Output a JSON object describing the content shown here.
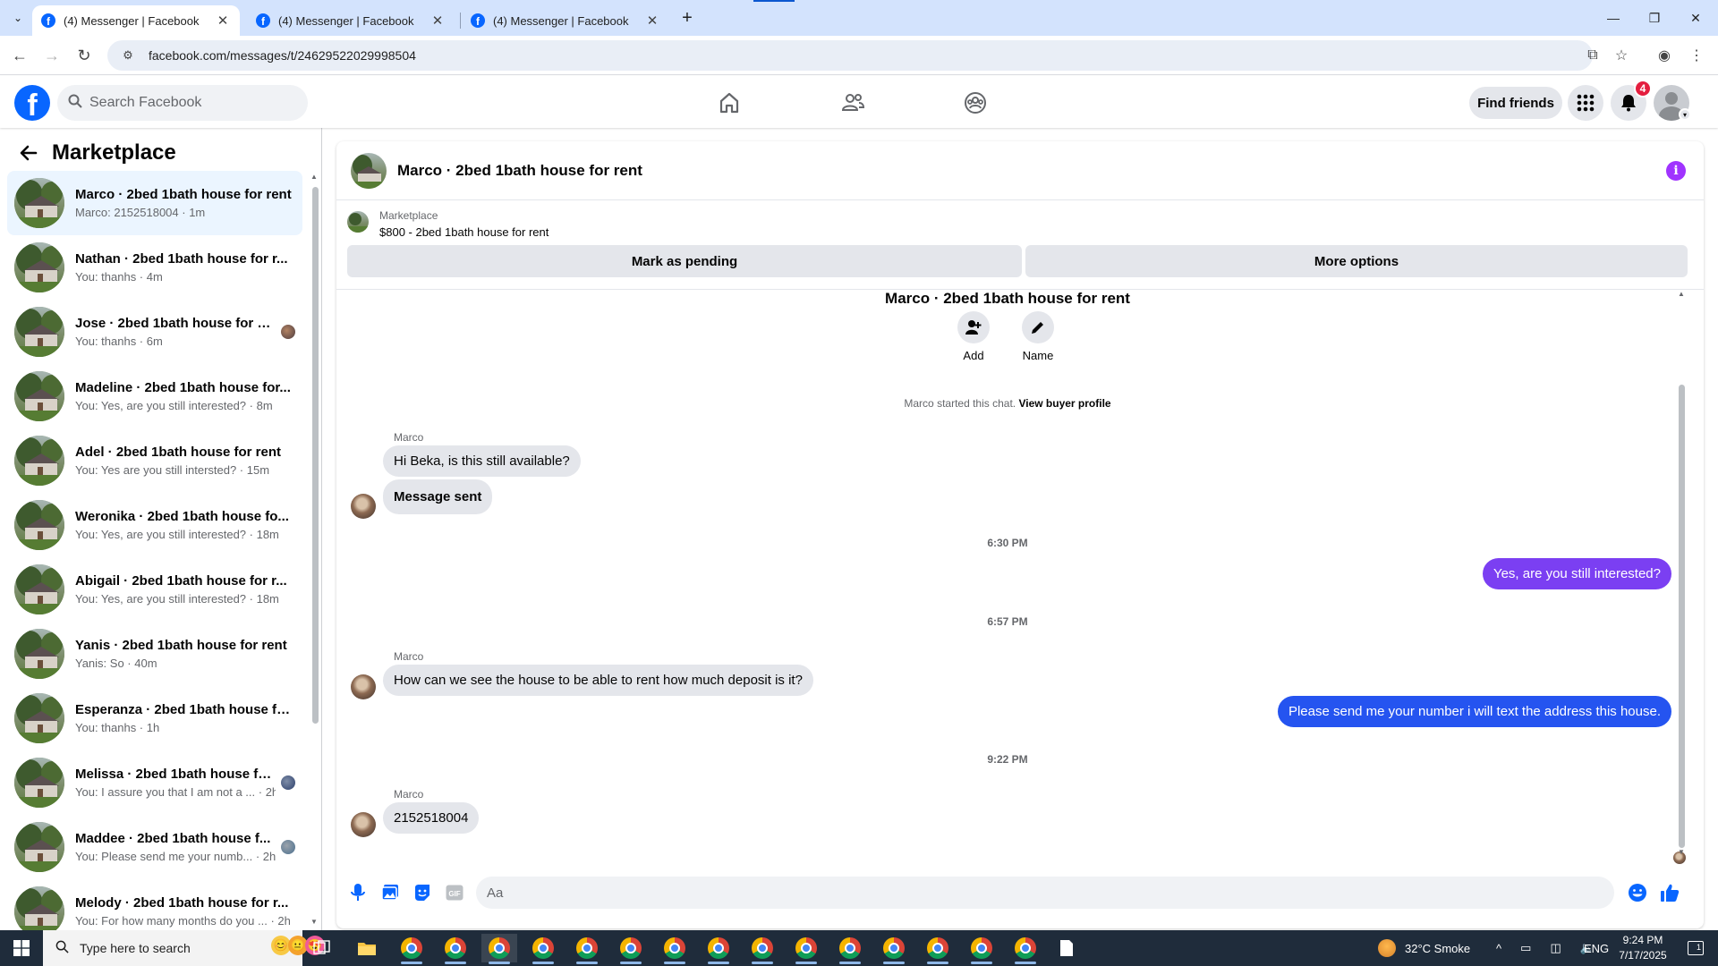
{
  "browser": {
    "tabs": [
      {
        "title": "(4) Messenger | Facebook",
        "active": true
      },
      {
        "title": "(4) Messenger | Facebook",
        "active": false
      },
      {
        "title": "(4) Messenger | Facebook",
        "active": false
      }
    ],
    "url": "facebook.com/messages/t/24629522029998504"
  },
  "header": {
    "search_placeholder": "Search Facebook",
    "find_friends": "Find friends",
    "notification_count": "4"
  },
  "sidebar": {
    "title": "Marketplace",
    "conversations": [
      {
        "name": "Marco · 2bed 1bath house for rent",
        "preview": "Marco: 2152518004 · 1m",
        "active": true
      },
      {
        "name": "Nathan · 2bed 1bath house for r...",
        "preview": "You: thanhs · 4m"
      },
      {
        "name": "Jose · 2bed 1bath house for re...",
        "preview": "You: thanhs · 6m",
        "seen": "seen-1"
      },
      {
        "name": "Madeline · 2bed 1bath house for...",
        "preview": "You: Yes, are you still interested? · 8m"
      },
      {
        "name": "Adel · 2bed 1bath house for rent",
        "preview": "You: Yes are you still intersted? · 15m"
      },
      {
        "name": "Weronika · 2bed 1bath house fo...",
        "preview": "You: Yes, are you still interested? · 18m"
      },
      {
        "name": "Abigail · 2bed 1bath house for r...",
        "preview": "You: Yes, are you still interested? · 18m"
      },
      {
        "name": "Yanis · 2bed 1bath house for rent",
        "preview": "Yanis: So · 40m"
      },
      {
        "name": "Esperanza · 2bed 1bath house fo...",
        "preview": "You: thanhs · 1h"
      },
      {
        "name": "Melissa · 2bed 1bath house fo...",
        "preview": "You: I assure you that I am not a ... · 2h",
        "seen": "seen-2"
      },
      {
        "name": "Maddee · 2bed 1bath house f...",
        "preview": "You: Please send me your numb... · 2h",
        "seen": "seen-3"
      },
      {
        "name": "Melody · 2bed 1bath house for r...",
        "preview": "You: For how many months do you ... · 2h"
      }
    ]
  },
  "chat": {
    "title": "Marco · 2bed 1bath house for rent",
    "marketplace_label": "Marketplace",
    "listing": "$800 - 2bed 1bath house for rent",
    "mark_pending": "Mark as pending",
    "more_options": "More options",
    "intro_title": "Marco · 2bed 1bath house for rent",
    "add_label": "Add",
    "name_label": "Name",
    "started_text": "Marco started this chat.",
    "view_buyer_profile": "View buyer profile",
    "sender_name": "Marco",
    "messages": {
      "m1": "Hi Beka, is this still available?",
      "m2": "Message sent",
      "t1": "6:30 PM",
      "m3": "Yes, are you still interested?",
      "t2": "6:57 PM",
      "m4": "How can we see the house to be able to rent how much deposit is it?",
      "m5": "Please send me your number i will text the address this house.",
      "t3": "9:22 PM",
      "m6": "2152518004"
    },
    "composer_placeholder": "Aa",
    "colors": {
      "outgoing_1": "#7b3ff2",
      "outgoing_2": "#2554f0",
      "accent": "#a033ff",
      "facebook_blue": "#0866ff"
    }
  },
  "taskbar": {
    "search_placeholder": "Type here to search",
    "weather": "32°C  Smoke",
    "language": "ENG",
    "time": "9:24 PM",
    "date": "7/17/2025",
    "notification_count": "1"
  }
}
